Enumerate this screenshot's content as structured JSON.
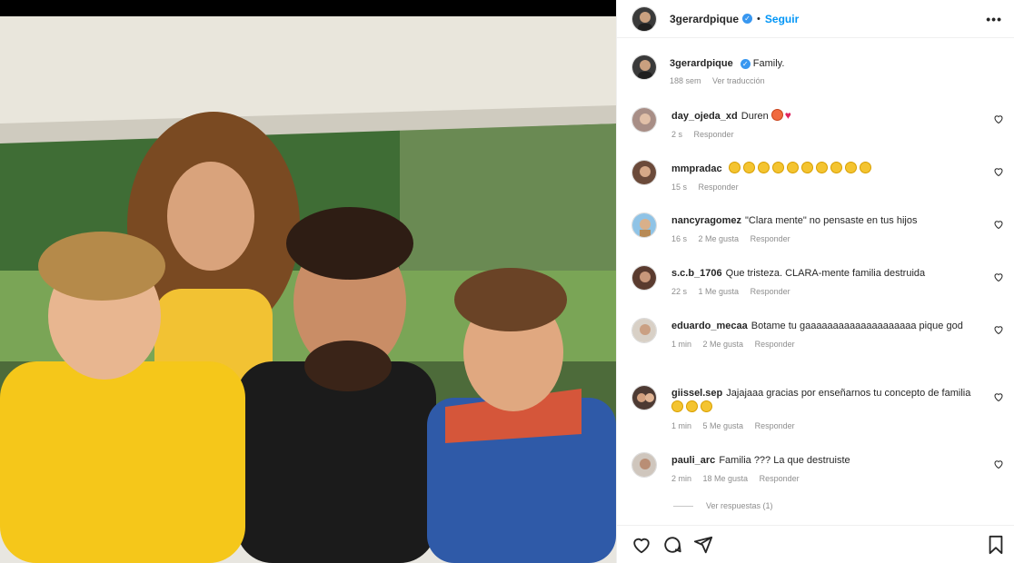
{
  "post": {
    "username": "3gerardpique",
    "follow_label": "Seguir",
    "separator": "•",
    "more_label": "•••",
    "caption_text": "Family.",
    "caption_time": "188 sem",
    "translate_label": "Ver traducción",
    "photo_alt": "family-photo"
  },
  "comments": [
    {
      "user": "day_ojeda_xd",
      "text": "Duren",
      "time": "2 s",
      "likes": "",
      "reply": "Responder",
      "emoji": "red-face-and-heart"
    },
    {
      "user": "mmpradac",
      "text": "",
      "time": "15 s",
      "likes": "",
      "reply": "Responder",
      "emoji": "laughing-faces-x10"
    },
    {
      "user": "nancyragomez",
      "text": "\"Clara mente\" no pensaste en tus hijos",
      "time": "16 s",
      "likes": "2 Me gusta",
      "reply": "Responder"
    },
    {
      "user": "s.c.b_1706",
      "text": "Que tristeza. CLARA-mente familia destruida",
      "time": "22 s",
      "likes": "1 Me gusta",
      "reply": "Responder"
    },
    {
      "user": "eduardo_mecaa",
      "text": "Botame tu gaaaaaaaaaaaaaaaaaaaa pique god",
      "time": "1 min",
      "likes": "2 Me gusta",
      "reply": "Responder"
    },
    {
      "user": "giissel.sep",
      "text": "Jajajaaa gracias por enseñarnos tu concepto de familia",
      "time": "1 min",
      "likes": "5 Me gusta",
      "reply": "Responder",
      "emoji": "laughing-faces-x3"
    },
    {
      "user": "pauli_arc",
      "text": "Familia ??? La que destruiste",
      "time": "2 min",
      "likes": "18 Me gusta",
      "reply": "Responder"
    }
  ],
  "view_replies_label": "Ver respuestas (1)",
  "icons": {
    "like": "heart-icon",
    "comment": "comment-icon",
    "share": "paper-plane-icon",
    "save": "bookmark-icon"
  },
  "colors": {
    "follow": "#0095f6",
    "meta": "#8e8e8e",
    "verified": "#3897f0"
  }
}
